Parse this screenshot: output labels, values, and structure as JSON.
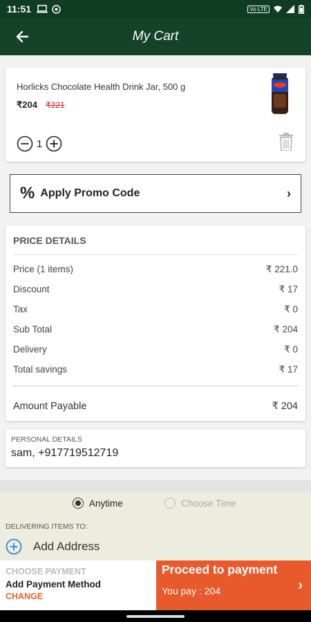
{
  "status_bar": {
    "time": "11:51",
    "network_label": "Vo LTE",
    "icons": [
      "laptop-icon",
      "vpn-icon",
      "wifi-icon",
      "signal-icon",
      "battery-icon"
    ]
  },
  "header": {
    "title": "My Cart",
    "back_icon": "arrow-left-icon"
  },
  "cart": {
    "item": {
      "name": "Horlicks Chocolate Health Drink Jar, 500 g",
      "price": "₹204",
      "mrp": "₹221",
      "quantity": "1"
    }
  },
  "promo": {
    "percent_symbol": "%",
    "label": "Apply Promo Code",
    "chevron": "›"
  },
  "price_details": {
    "heading": "PRICE DETAILS",
    "rows": [
      {
        "label": "Price (1 items)",
        "value": "₹ 221.0"
      },
      {
        "label": "Discount",
        "value": "₹ 17"
      },
      {
        "label": "Tax",
        "value": "₹ 0"
      },
      {
        "label": "Sub Total",
        "value": "₹ 204"
      },
      {
        "label": "Delivery",
        "value": "₹ 0"
      },
      {
        "label": "Total savings",
        "value": "₹ 17"
      }
    ],
    "total_label": "Amount Payable",
    "total_value": "₹ 204"
  },
  "personal": {
    "label": "PERSONAL DETAILS",
    "value": "sam, +917719512719"
  },
  "delivery": {
    "option_anytime": "Anytime",
    "option_choose_time": "Choose Time",
    "selected": "Anytime",
    "delivering_label": "DELIVERING ITEMS TO:",
    "add_address": "Add Address"
  },
  "bottom": {
    "choose_payment": "CHOOSE PAYMENT",
    "add_payment_method": "Add Payment Method",
    "change": "CHANGE",
    "proceed": "Proceed to payment",
    "you_pay": "You pay : 204",
    "arrow": "›"
  },
  "colors": {
    "header_bg": "#14432a",
    "accent_orange": "#e8592c",
    "mrp_red": "#e02020",
    "delivery_bg": "#ededdf"
  }
}
